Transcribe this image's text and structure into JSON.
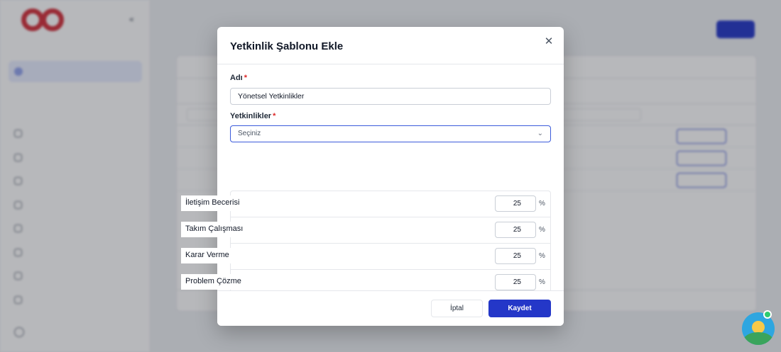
{
  "modal": {
    "title": "Yetkinlik Şablonu Ekle",
    "name_label": "Adı",
    "name_value": "Yönetsel Yetkinlikler",
    "competencies_label": "Yetkinlikler",
    "required_mark": "*",
    "select_placeholder": "Seçiniz",
    "competencies": [
      {
        "name": "İletişim Becerisi",
        "weight": "25"
      },
      {
        "name": "Takım Çalışması",
        "weight": "25"
      },
      {
        "name": "Karar Verme",
        "weight": "25"
      },
      {
        "name": "Problem Çözme",
        "weight": "25"
      }
    ],
    "percent_sign": "%",
    "cancel_label": "İptal",
    "save_label": "Kaydet"
  },
  "colors": {
    "primary": "#2437c8",
    "required": "#dc2626",
    "select_focus": "#3b5bdb",
    "brand_logo": "#d32f3a",
    "chat_online": "#2ecc71"
  },
  "icons": {
    "close": "close-icon",
    "select": "chevron-down-icon",
    "chat": "chat-widget-icon"
  }
}
